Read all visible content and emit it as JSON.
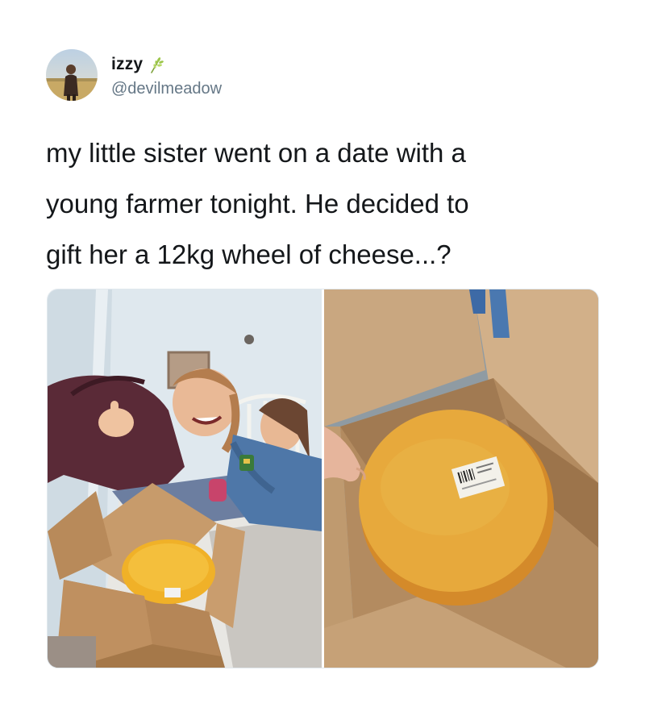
{
  "user": {
    "display_name": "izzy",
    "handle": "@devilmeadow",
    "name_emoji": "wheat-sprig-icon"
  },
  "tweet": {
    "text": "my little sister went on a date with a\nyoung farmer tonight. He decided to\ngift her a 12kg wheel of cheese...?"
  },
  "media": {
    "photo_count": 2
  },
  "colors": {
    "text": "#14171a",
    "handle": "#657786",
    "cheese": "#e7a93c"
  }
}
